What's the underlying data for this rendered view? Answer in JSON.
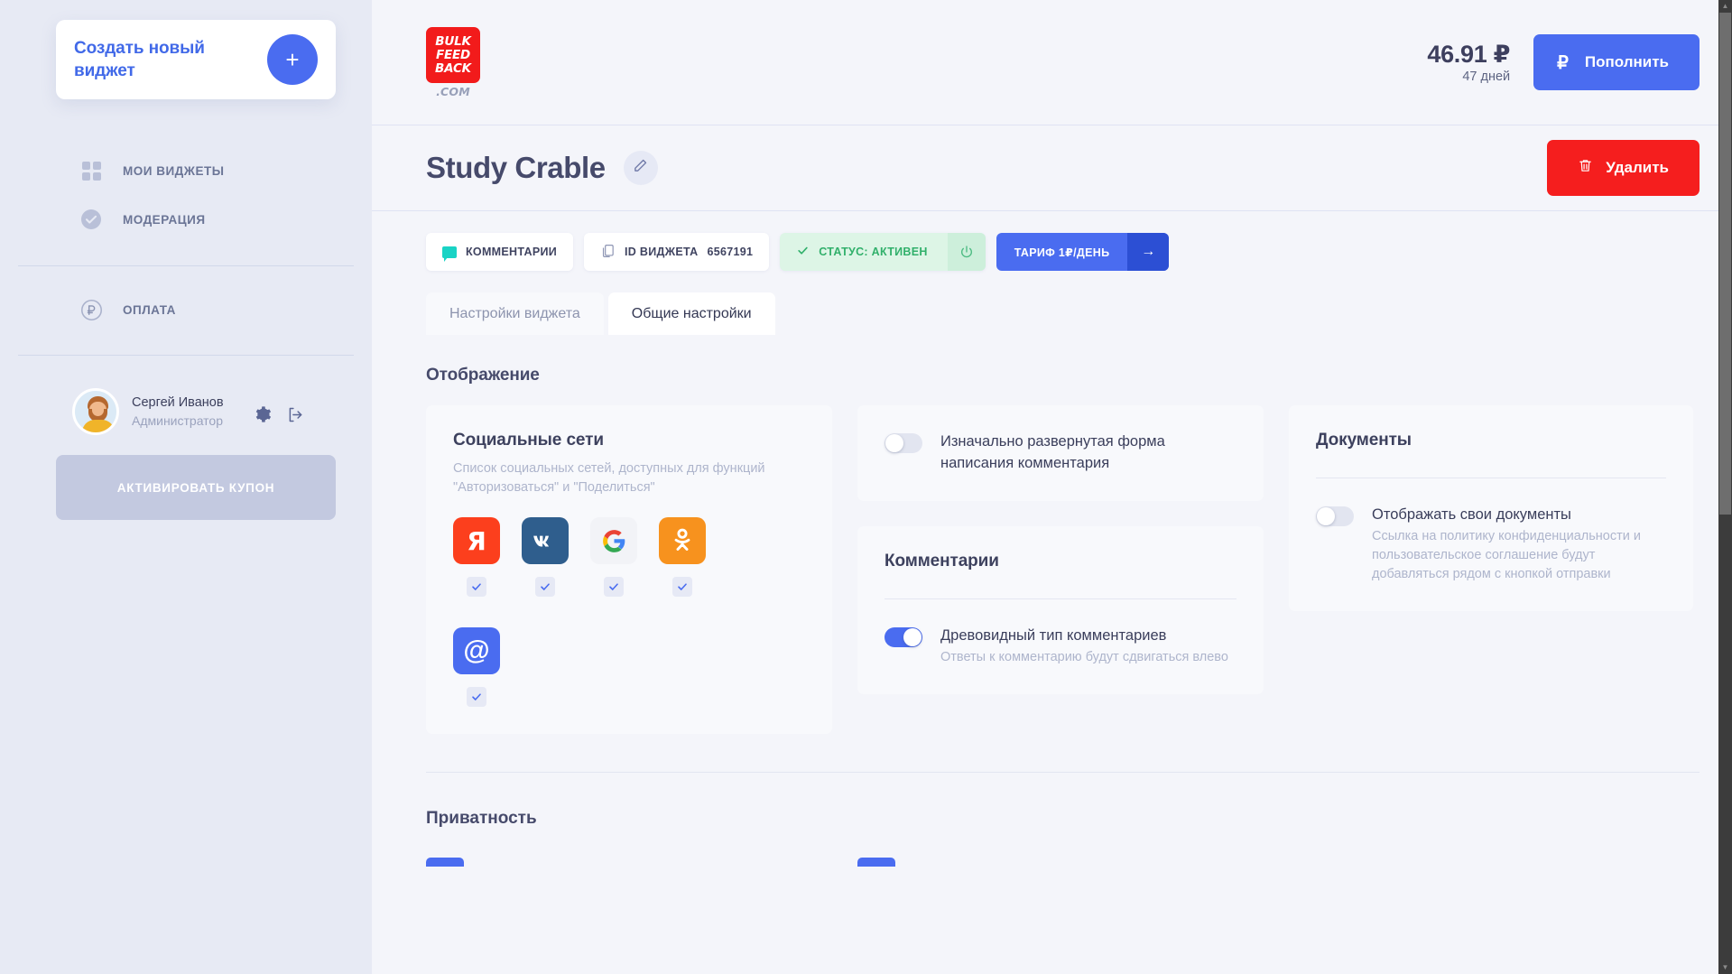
{
  "sidebar": {
    "create_widget_label": "Создать новый виджет",
    "create_plus": "+",
    "nav": [
      {
        "label": "МОИ ВИДЖЕТЫ",
        "icon": "grid-icon"
      },
      {
        "label": "МОДЕРАЦИЯ",
        "icon": "check-circle-icon"
      }
    ],
    "payment": {
      "label": "ОПЛАТА",
      "icon": "ruble-circle-icon"
    },
    "profile": {
      "name": "Сергей Иванов",
      "role": "Администратор"
    },
    "coupon_label": "АКТИВИРОВАТЬ КУПОН"
  },
  "header": {
    "logo": {
      "line1": "BULK",
      "line2": "FEED",
      "line3": "BACK",
      "domain": ".COM"
    },
    "balance": {
      "amount": "46.91 ₽",
      "days": "47 дней"
    },
    "topup_label": "Пополнить",
    "topup_icon": "₽"
  },
  "title_bar": {
    "title": "Study Crable",
    "edit_icon": "pencil-icon",
    "delete_label": "Удалить",
    "delete_icon": "trash-icon"
  },
  "chips": {
    "comments": "КОММЕНТАРИИ",
    "widget_id_label": "ID ВИДЖЕТА",
    "widget_id_value": "6567191",
    "status": "СТАТУС: АКТИВЕН",
    "tariff": "ТАРИФ 1₽/ДЕНЬ",
    "tariff_arrow": "→"
  },
  "tabs": [
    {
      "label": "Настройки виджета",
      "active": false
    },
    {
      "label": "Общие настройки",
      "active": true
    }
  ],
  "sections": {
    "display_title": "Отображение",
    "privacy_title": "Приватность"
  },
  "social_card": {
    "title": "Социальные сети",
    "subtitle": "Список социальных сетей, доступных для функций \"Авторизоваться\" и \"Поделиться\"",
    "networks": [
      {
        "name": "yandex",
        "glyph": "Я",
        "checked": true
      },
      {
        "name": "vkontakte",
        "glyph": "VK",
        "checked": true
      },
      {
        "name": "google",
        "glyph": "G",
        "checked": true
      },
      {
        "name": "odnoklassniki",
        "glyph": "OK",
        "checked": true
      },
      {
        "name": "email",
        "glyph": "@",
        "checked": true
      }
    ]
  },
  "expanded_form_card": {
    "label": "Изначально развернутая форма написания комментария",
    "enabled": false
  },
  "comments_card": {
    "title": "Комментарии",
    "tree_label": "Древовидный тип комментариев",
    "tree_hint": "Ответы к комментарию будут сдвигаться влево",
    "tree_enabled": true
  },
  "documents_card": {
    "title": "Документы",
    "toggle_label": "Отображать свои документы",
    "toggle_hint": "Ссылка на политику конфиденциальности и пользовательское соглашение будут добавляться рядом с кнопкой отправки",
    "enabled": false
  },
  "colors": {
    "accent": "#4a6cf0",
    "danger": "#f51e1e",
    "sidebar_bg": "#e7eaf4",
    "main_bg": "#f4f5fa",
    "card_bg": "#f8f9fc",
    "success": "#31b06b"
  }
}
